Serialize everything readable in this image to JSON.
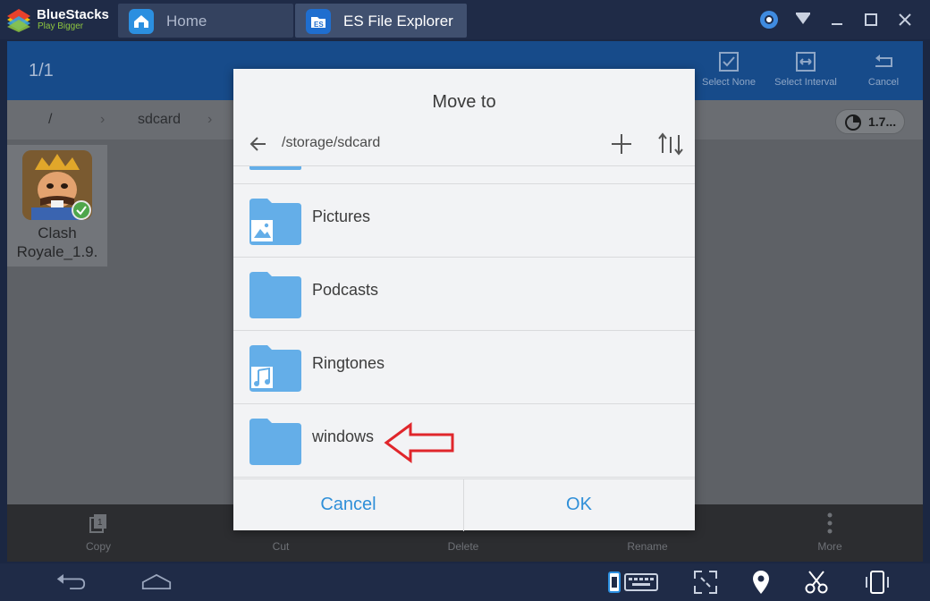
{
  "bluestacks": {
    "name": "BlueStacks",
    "tagline": "Play Bigger"
  },
  "tabs": [
    {
      "label": "Home",
      "icon": "home-icon"
    },
    {
      "label": "ES File Explorer",
      "icon": "es-file-explorer-icon"
    }
  ],
  "window_controls": [
    "account-icon",
    "menu-icon",
    "minimize-icon",
    "maximize-icon",
    "close-icon"
  ],
  "actionbar": {
    "counter": "1/1",
    "select_none": "Select None",
    "select_interval": "Select Interval",
    "cancel": "Cancel"
  },
  "pathbar": {
    "root": "/",
    "folder": "sdcard",
    "storage": "1.7..."
  },
  "file": {
    "name_line1": "Clash",
    "name_line2": "Royale_1.9."
  },
  "bottom_actions": {
    "copy": "Copy",
    "cut": "Cut",
    "delete": "Delete",
    "rename": "Rename",
    "more": "More"
  },
  "dialog": {
    "title": "Move to",
    "path": "/storage/sdcard",
    "folders": [
      {
        "label": "Pictures",
        "icon": "pictures-folder-icon"
      },
      {
        "label": "Podcasts",
        "icon": "folder-icon"
      },
      {
        "label": "Ringtones",
        "icon": "ringtones-folder-icon"
      },
      {
        "label": "windows",
        "icon": "folder-icon"
      }
    ],
    "cancel": "Cancel",
    "ok": "OK"
  },
  "colors": {
    "accent": "#2f8fd8",
    "folder": "#64aee8",
    "actionbar": "#174b8a",
    "annotation": "#e0262b"
  }
}
